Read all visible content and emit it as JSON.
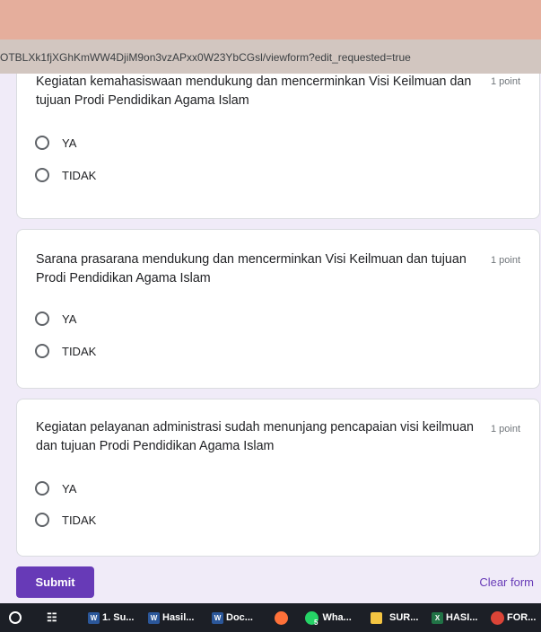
{
  "browser": {
    "url": "OTBLXk1fjXGhKmWW4DjiM9on3vzAPxx0W23YbCGsl/viewform?edit_requested=true"
  },
  "questions": [
    {
      "text": "Kegiatan kemahasiswaan mendukung dan mencerminkan Visi Keilmuan dan tujuan  Prodi Pendidikan Agama Islam",
      "points": "1 point",
      "options": [
        "YA",
        "TIDAK"
      ]
    },
    {
      "text": "Sarana prasarana mendukung dan mencerminkan Visi Keilmuan dan tujuan  Prodi Pendidikan Agama Islam",
      "points": "1 point",
      "options": [
        "YA",
        "TIDAK"
      ]
    },
    {
      "text": "Kegiatan pelayanan administrasi sudah menunjang pencapaian visi keilmuan dan tujuan Prodi Pendidikan Agama Islam",
      "points": "1 point",
      "options": [
        "YA",
        "TIDAK"
      ]
    }
  ],
  "form": {
    "submit_label": "Submit",
    "clear_label": "Clear form"
  },
  "taskbar": {
    "items": [
      {
        "label": "1. Su...",
        "icon": "word-icon"
      },
      {
        "label": "Hasil...",
        "icon": "word-icon"
      },
      {
        "label": "Doc...",
        "icon": "word-icon"
      },
      {
        "label": "",
        "icon": "firefox-icon"
      },
      {
        "label": "Wha...",
        "icon": "whatsapp-icon",
        "badge": "5"
      },
      {
        "label": "SUR...",
        "icon": "folder-icon"
      },
      {
        "label": "HASI...",
        "icon": "excel-icon"
      },
      {
        "label": "FOR...",
        "icon": "chrome-icon"
      }
    ]
  },
  "colors": {
    "accent": "#673ab7",
    "background": "#f0ebf8",
    "titlebar": "#e5ae9c"
  }
}
